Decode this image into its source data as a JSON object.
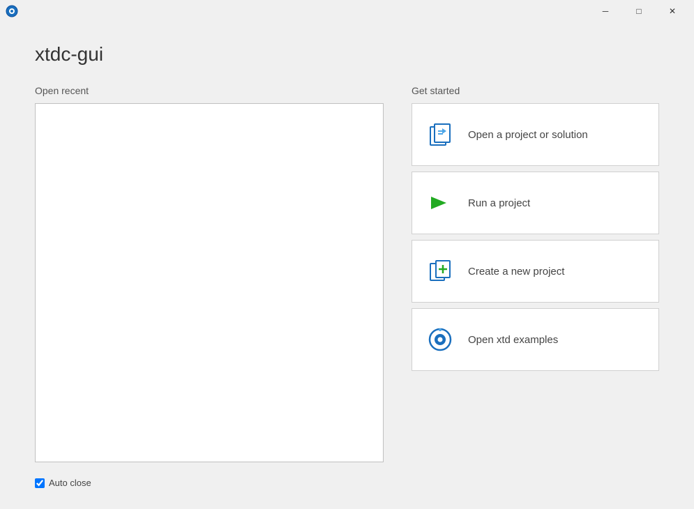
{
  "titleBar": {
    "appName": "xtdc-gui",
    "minBtn": "─",
    "maxBtn": "□",
    "closeBtn": "✕"
  },
  "appTitle": "xtdc-gui",
  "leftPanel": {
    "sectionLabel": "Open recent",
    "recentItems": []
  },
  "rightPanel": {
    "sectionLabel": "Get started",
    "actions": [
      {
        "id": "open-project",
        "label": "Open a project or solution",
        "iconType": "open-project"
      },
      {
        "id": "run-project",
        "label": "Run a project",
        "iconType": "run"
      },
      {
        "id": "create-project",
        "label": "Create a new project",
        "iconType": "create"
      },
      {
        "id": "open-examples",
        "label": "Open xtd examples",
        "iconType": "examples"
      }
    ]
  },
  "footer": {
    "autoCloseLabel": "Auto close",
    "autoCloseChecked": true
  }
}
